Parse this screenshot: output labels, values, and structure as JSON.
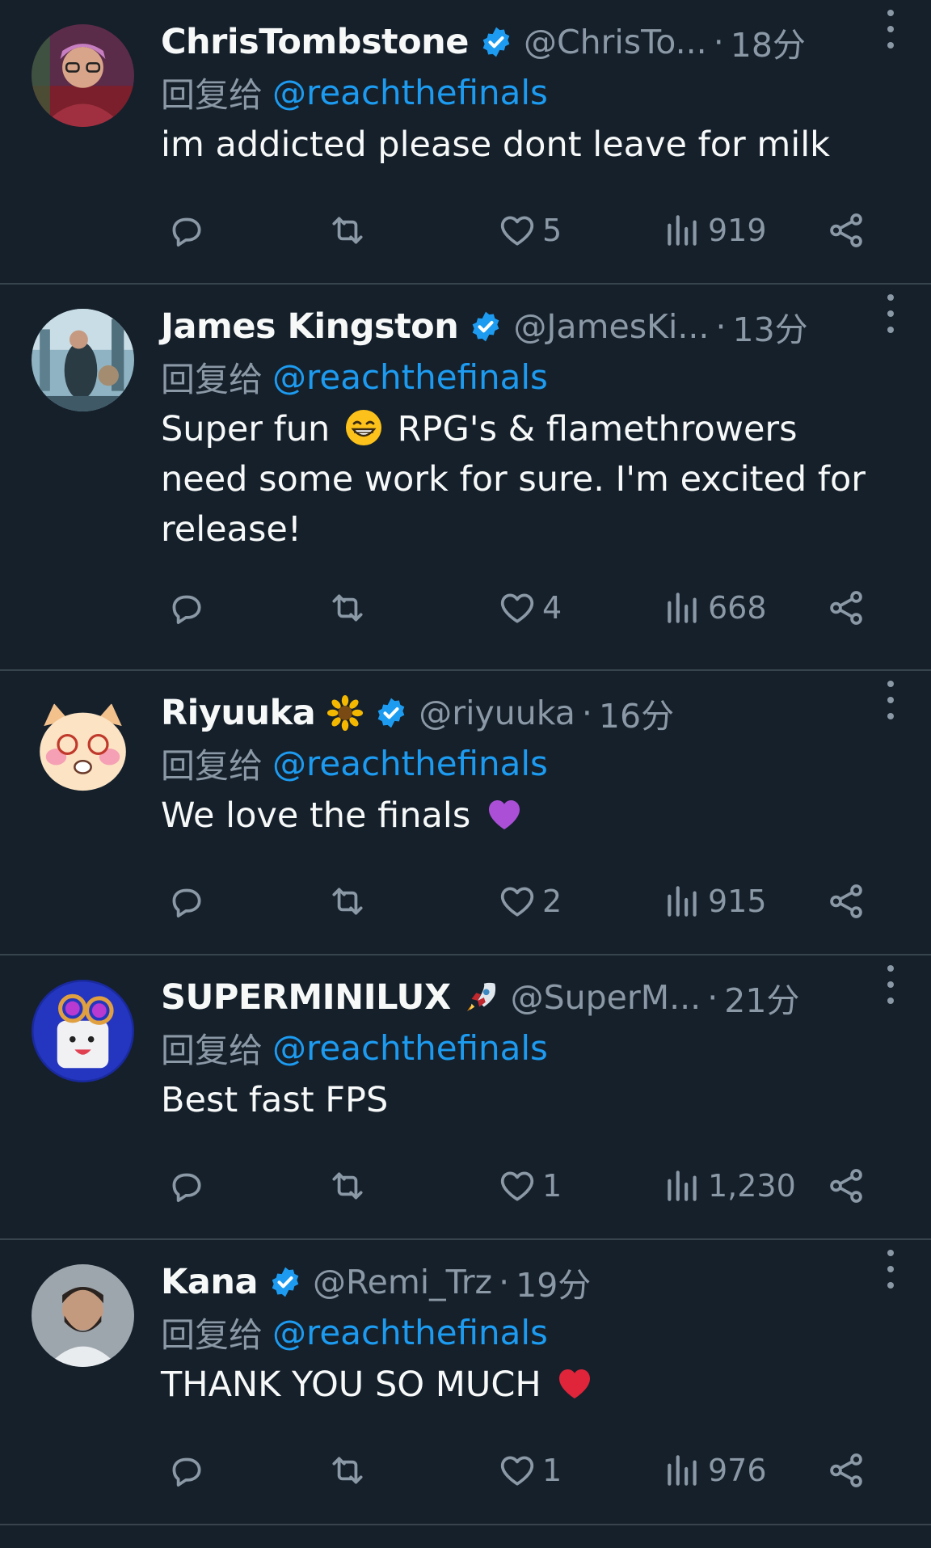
{
  "colors": {
    "background": "#15202b",
    "text": "#f7f9f9",
    "muted": "#8b98a5",
    "link": "#1d9bf0",
    "divider": "#38444d",
    "verified": "#1d9bf0"
  },
  "reply_prefix": "回复给",
  "icons": {
    "reply": "reply-icon",
    "retweet": "retweet-icon",
    "like": "heart-icon",
    "views": "views-chart-icon",
    "share": "share-icon",
    "more": "more-options-icon",
    "verified": "verified-badge-icon"
  },
  "tweets": [
    {
      "name": "ChrisTombstone",
      "name_emoji": "",
      "handle": "@ChrisTo...",
      "time": "18分",
      "reply_to": "@reachthefinals",
      "text": "im addicted please dont leave for milk",
      "text_emoji": "",
      "likes": "5",
      "views": "919"
    },
    {
      "name": "James Kingston",
      "name_emoji": "",
      "handle": "@JamesKi...",
      "time": "13分",
      "reply_to": "@reachthefinals",
      "text_before": "Super fun",
      "text_after": " RPG's & flamethrowers need some work for sure. I'm excited for release!",
      "text_emoji": "grinning-face",
      "likes": "4",
      "views": "668"
    },
    {
      "name": "Riyuuka",
      "name_emoji": "sunflower",
      "handle": "@riyuuka",
      "time": "16分",
      "reply_to": "@reachthefinals",
      "text": "We love the finals",
      "text_emoji": "purple-heart",
      "likes": "2",
      "views": "915"
    },
    {
      "name": "SUPERMINILUX",
      "name_emoji": "rocket",
      "handle": "@SuperM...",
      "time": "21分",
      "reply_to": "@reachthefinals",
      "text": "Best fast FPS",
      "text_emoji": "",
      "likes": "1",
      "views": "1,230"
    },
    {
      "name": "Kana",
      "name_emoji": "",
      "handle": "@Remi_Trz",
      "time": "19分",
      "reply_to": "@reachthefinals",
      "text": "THANK YOU SO MUCH",
      "text_emoji": "red-heart",
      "likes": "1",
      "views": "976"
    }
  ]
}
